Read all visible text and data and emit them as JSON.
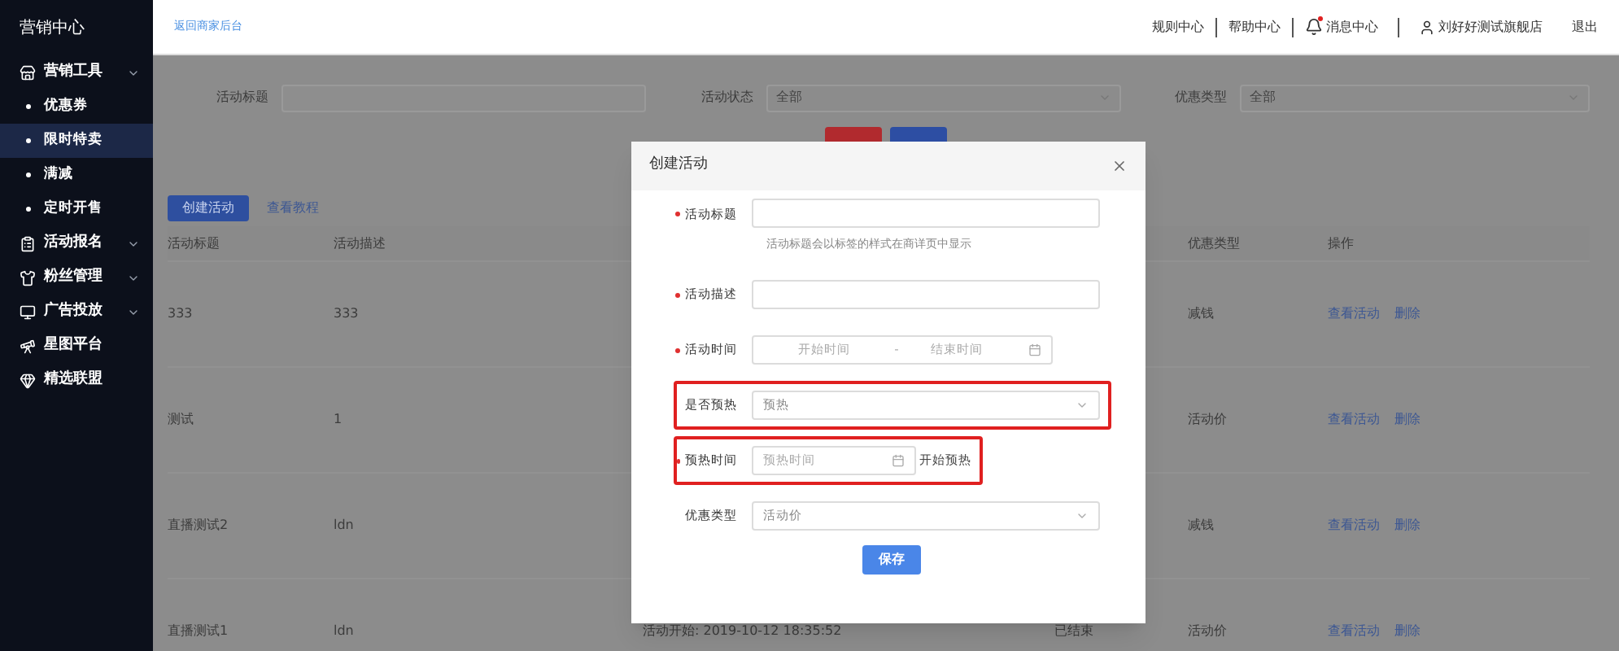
{
  "sidebar": {
    "title": "营销中心",
    "items": [
      {
        "label": "营销工具",
        "collapsible": true,
        "children": [
          {
            "label": "优惠券",
            "selected": false
          },
          {
            "label": "限时特卖",
            "selected": true
          },
          {
            "label": "满减",
            "selected": false
          },
          {
            "label": "定时开售",
            "selected": false
          }
        ]
      },
      {
        "label": "活动报名",
        "collapsible": true
      },
      {
        "label": "粉丝管理",
        "collapsible": true
      },
      {
        "label": "广告投放",
        "collapsible": true
      },
      {
        "label": "星图平台",
        "collapsible": false
      },
      {
        "label": "精选联盟",
        "collapsible": false
      }
    ]
  },
  "header": {
    "back_link": "返回商家后台",
    "links": [
      "规则中心",
      "帮助中心"
    ],
    "messages": {
      "label": "消息中心",
      "unread": true
    },
    "user": "刘好好测试旗舰店",
    "logout": "退出"
  },
  "filters": [
    {
      "label": "活动标题",
      "kind": "input"
    },
    {
      "label": "活动状态",
      "kind": "select",
      "value": "全部"
    },
    {
      "label": "优惠类型",
      "kind": "select",
      "value": "全部"
    }
  ],
  "filter_buttons": [
    {
      "kind": "danger"
    },
    {
      "kind": "primary"
    }
  ],
  "toolbar": {
    "create_button": "创建活动",
    "tutorial_link": "查看教程"
  },
  "table": {
    "columns": [
      "活动标题",
      "活动描述",
      "优惠类型",
      "操作"
    ],
    "rows": [
      {
        "title": "333",
        "description": "333",
        "discount_type": "减钱",
        "actions": [
          "查看活动",
          "删除"
        ]
      },
      {
        "title": "测试",
        "description": "1",
        "discount_type": "活动价",
        "actions": [
          "查看活动",
          "删除"
        ]
      },
      {
        "title": "直播测试2",
        "description": "ldn",
        "discount_type": "减钱",
        "actions": [
          "查看活动",
          "删除"
        ]
      },
      {
        "title": "直播测试1",
        "description": "ldn",
        "column_3": "活动开始: 2019-10-12 18:35:52",
        "column_4": "已结束",
        "discount_type": "活动价",
        "actions": [
          "查看活动",
          "删除"
        ]
      }
    ]
  },
  "dialog": {
    "title": "创建活动",
    "fields": [
      {
        "label": "活动标题",
        "kind": "input",
        "required": true,
        "highlighted": false,
        "hint": "活动标题会以标签的样式在商详页中显示"
      },
      {
        "label": "活动描述",
        "kind": "input",
        "required": true,
        "highlighted": false
      },
      {
        "label": "活动时间",
        "kind": "range",
        "required": true,
        "highlighted": false,
        "start_placeholder": "开始时间",
        "separator": "-",
        "end_placeholder": "结束时间"
      },
      {
        "label": "是否预热",
        "kind": "select",
        "required": false,
        "highlighted": true,
        "value": "预热"
      },
      {
        "label": "预热时间",
        "kind": "date",
        "required": true,
        "highlighted": true,
        "placeholder": "预热时间",
        "suffix": "开始预热"
      },
      {
        "label": "优惠类型",
        "kind": "select",
        "required": false,
        "highlighted": false,
        "value": "活动价"
      }
    ],
    "save_button": "保存"
  }
}
